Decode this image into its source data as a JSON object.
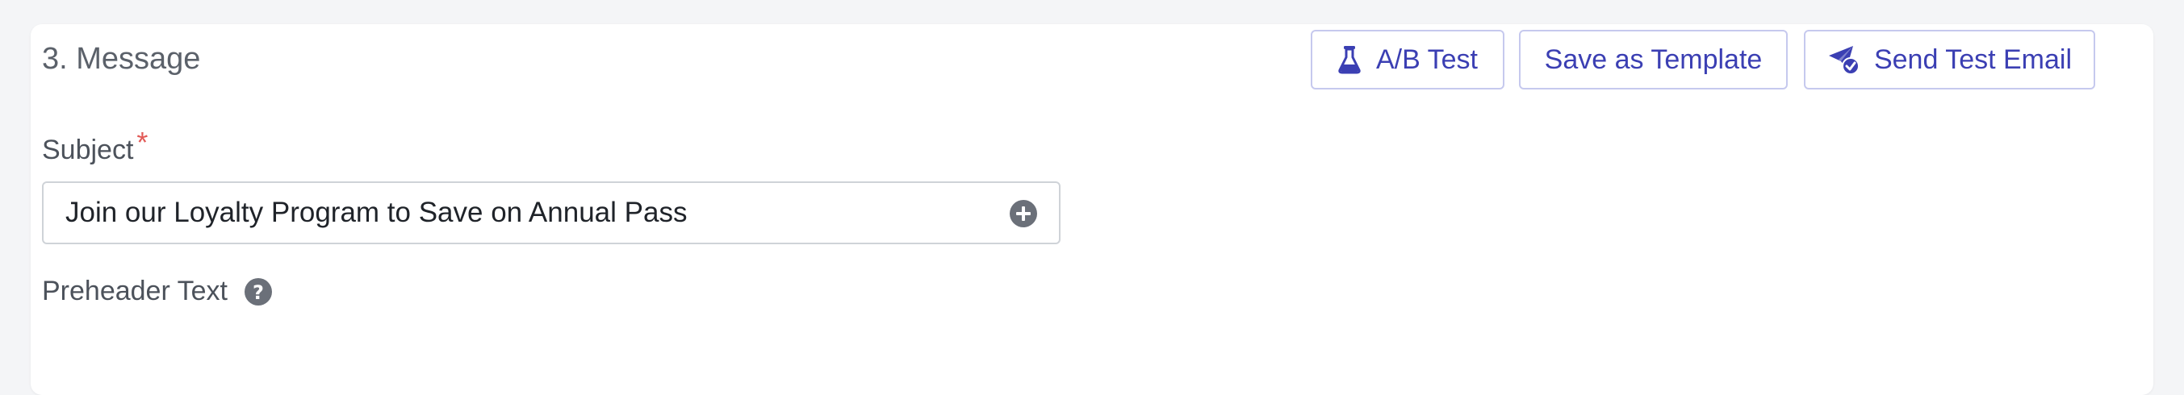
{
  "section": {
    "title": "3. Message"
  },
  "toolbar": {
    "ab_test_label": "A/B Test",
    "save_template_label": "Save as Template",
    "send_test_label": "Send Test Email"
  },
  "fields": {
    "subject": {
      "label": "Subject",
      "required_marker": "*",
      "value": "Join our Loyalty Program to Save on Annual Pass"
    },
    "preheader": {
      "label": "Preheader Text"
    }
  },
  "icons": {
    "ab_test": "flask-icon",
    "send_test": "paper-plane-check-icon",
    "add_personalization": "plus-circle-icon",
    "help": "question-circle-icon"
  },
  "colors": {
    "accent": "#3b3fb3",
    "button_border": "#c6c9ee",
    "required": "#e25a57",
    "icon_gray": "#6b7079"
  }
}
